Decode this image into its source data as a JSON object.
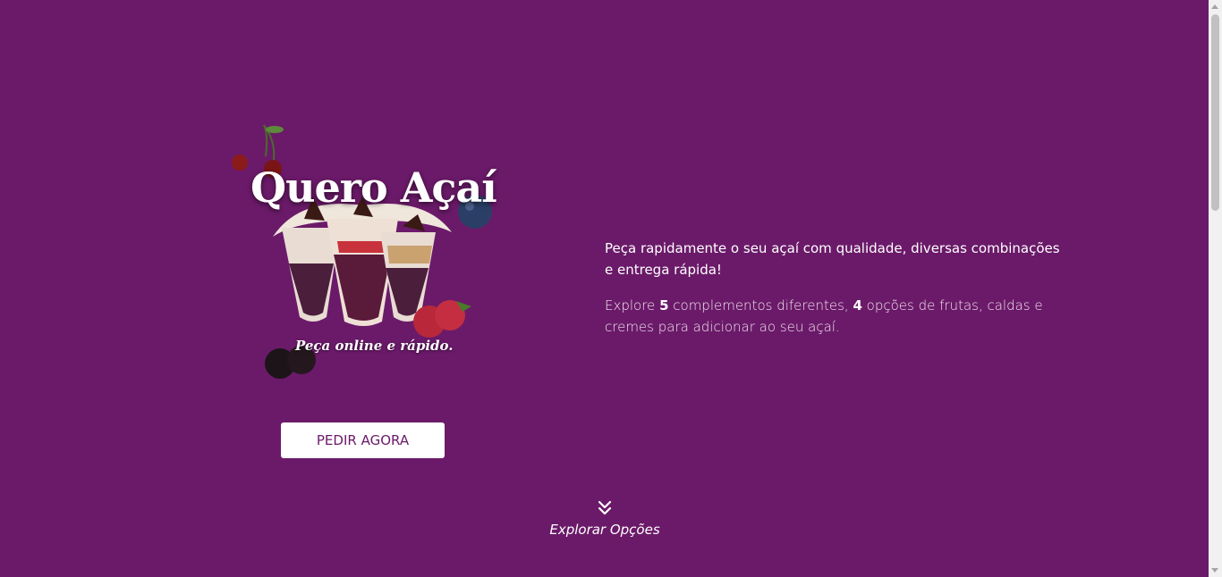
{
  "hero": {
    "brand_title": "Quero Açaí",
    "brand_tagline": "Peça online e rápido.",
    "cta_label": "PEDIR AGORA"
  },
  "intro": {
    "lead": "Peça rapidamente o seu açaí com qualidade, diversas combinações e entrega rápida!",
    "detail_prefix": "Explore ",
    "complements_count": "5",
    "detail_mid": " complementos diferentes, ",
    "fruit_options_count": "4",
    "detail_suffix": " opções de frutas, caldas e cremes para adicionar ao seu açaí."
  },
  "explore": {
    "label": "Explorar Opções",
    "icon": "double-chevron-down-icon"
  },
  "colors": {
    "background": "#6b1a69",
    "button_bg": "#ffffff",
    "button_text": "#6b1a69"
  }
}
